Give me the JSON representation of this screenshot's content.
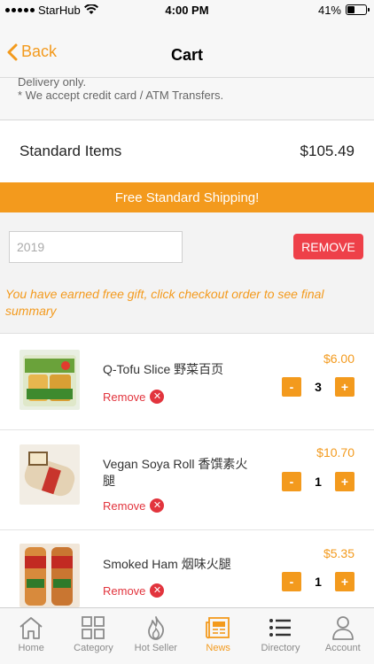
{
  "status_bar": {
    "carrier": "StarHub",
    "time": "4:00 PM",
    "battery": "41%",
    "battery_level": 0.41
  },
  "nav": {
    "back_label": "Back",
    "title": "Cart"
  },
  "notes": {
    "line1": "Delivery only.",
    "line2": "* We accept credit card / ATM Transfers."
  },
  "summary": {
    "label": "Standard Items",
    "total": "$105.49"
  },
  "shipping_banner": "Free Standard Shipping!",
  "coupon": {
    "value": "2019",
    "remove_label": "REMOVE"
  },
  "gift_message": "You have earned free gift, click checkout order to see final summary",
  "items": [
    {
      "name": "Q-Tofu Slice 野菜百页",
      "price": "$6.00",
      "qty": "3",
      "remove_label": "Remove"
    },
    {
      "name": "Vegan Soya Roll 香馔素火腿",
      "price": "$10.70",
      "qty": "1",
      "remove_label": "Remove"
    },
    {
      "name": "Smoked Ham 烟味火腿",
      "price": "$5.35",
      "qty": "1",
      "remove_label": "Remove"
    }
  ],
  "stepper": {
    "minus": "-",
    "plus": "+"
  },
  "tabs": [
    {
      "label": "Home",
      "icon": "home-icon"
    },
    {
      "label": "Category",
      "icon": "grid-icon"
    },
    {
      "label": "Hot Seller",
      "icon": "flame-icon"
    },
    {
      "label": "News",
      "icon": "newspaper-icon",
      "active": true
    },
    {
      "label": "Directory",
      "icon": "list-icon"
    },
    {
      "label": "Account",
      "icon": "person-icon"
    }
  ],
  "colors": {
    "accent": "#f39a1d",
    "danger": "#ee4049"
  }
}
